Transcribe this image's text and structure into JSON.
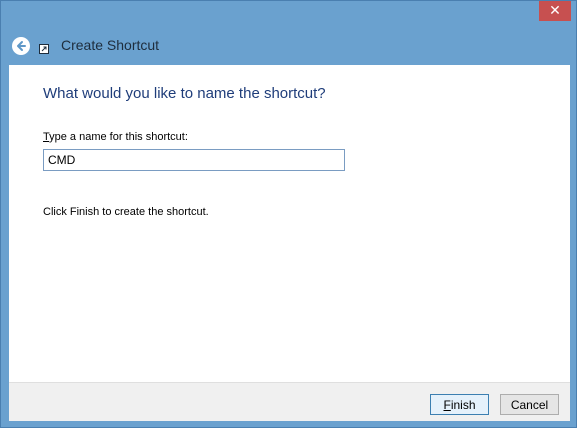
{
  "window": {
    "title": "Create Shortcut",
    "close_glyph": "✕"
  },
  "icons": {
    "back": "back-arrow-icon",
    "app": "shortcut-icon",
    "close": "close-icon"
  },
  "main": {
    "heading": "What would you like to name the shortcut?",
    "field_label_accel": "T",
    "field_label_rest": "ype a name for this shortcut:",
    "field_value": "CMD",
    "hint": "Click Finish to create the shortcut."
  },
  "footer": {
    "finish_accel": "F",
    "finish_rest": "inish",
    "cancel_label": "Cancel"
  },
  "colors": {
    "frame": "#6aa1cf",
    "close_button": "#c75050",
    "heading": "#1f3d7a",
    "focus_border": "#3c7fb1"
  }
}
